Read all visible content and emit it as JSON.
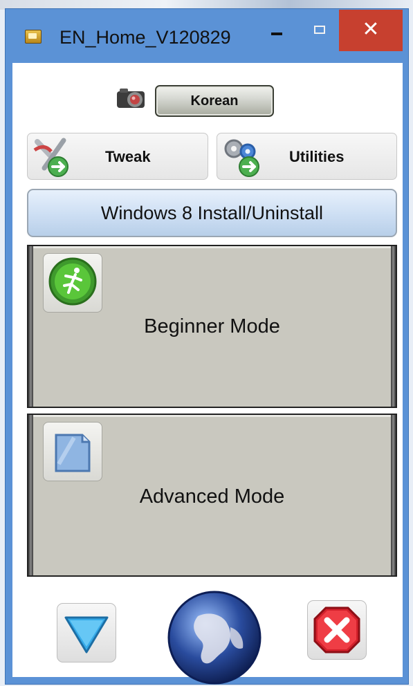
{
  "window": {
    "title": "EN_Home_V120829",
    "minimize_symbol": "",
    "maximize_symbol": "",
    "close_symbol": "✕"
  },
  "toolbar": {
    "language_button": "Korean",
    "tweak_button": "Tweak",
    "utilities_button": "Utilities",
    "win8_button": "Windows 8 Install/Uninstall"
  },
  "modes": {
    "beginner": "Beginner Mode",
    "advanced": "Advanced Mode"
  },
  "icons": {
    "camera": "camera-icon",
    "tweak": "tools-arrow-icon",
    "utilities": "gears-arrow-icon",
    "beginner": "runner-icon",
    "advanced": "document-icon",
    "down": "down-arrow-icon",
    "globe": "globe-icon",
    "close": "red-close-icon"
  },
  "colors": {
    "titlebar_blue": "#5b92d6",
    "close_red": "#c7402f",
    "panel_gray": "#c9c8bf"
  }
}
